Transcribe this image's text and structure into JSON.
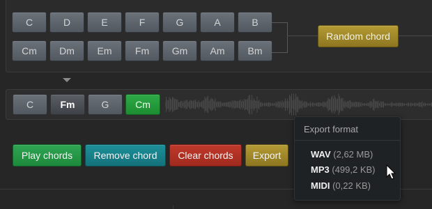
{
  "palette": {
    "major": [
      "C",
      "D",
      "E",
      "F",
      "G",
      "A",
      "B"
    ],
    "minor": [
      "Cm",
      "Dm",
      "Em",
      "Fm",
      "Gm",
      "Am",
      "Bm"
    ],
    "random_label": "Random chord"
  },
  "timeline": {
    "chords": [
      "C",
      "Fm",
      "G",
      "Cm"
    ],
    "selected_index": 1,
    "last_added_index": 3
  },
  "actions": {
    "play": "Play chords",
    "remove": "Remove chord",
    "clear": "Clear chords",
    "export": "Export"
  },
  "export_menu": {
    "title": "Export format",
    "items": [
      {
        "format": "WAV",
        "size": "(2,62 MB)"
      },
      {
        "format": "MP3",
        "size": "(499,2 KB)"
      },
      {
        "format": "MIDI",
        "size": "(0,22 KB)"
      }
    ]
  },
  "colors": {
    "play": "#2fa552",
    "remove": "#1c8f99",
    "clear": "#c0392b",
    "export": "#b59b34",
    "chord_added": "#2eaa46"
  }
}
